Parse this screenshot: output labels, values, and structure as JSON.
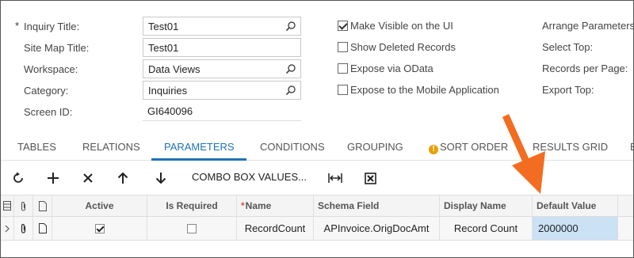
{
  "form": {
    "required_star": "*",
    "inquiry_title": {
      "label": "Inquiry Title:",
      "value": "Test01"
    },
    "site_map_title": {
      "label": "Site Map Title:",
      "value": "Test01"
    },
    "workspace": {
      "label": "Workspace:",
      "value": "Data Views"
    },
    "category": {
      "label": "Category:",
      "value": "Inquiries"
    },
    "screen_id": {
      "label": "Screen ID:",
      "value": "GI640096"
    }
  },
  "options": {
    "make_visible": {
      "label": "Make Visible on the UI",
      "checked": true
    },
    "show_deleted": {
      "label": "Show Deleted Records",
      "checked": false
    },
    "expose_odata": {
      "label": "Expose via OData",
      "checked": false
    },
    "expose_mobile": {
      "label": "Expose to the Mobile Application",
      "checked": false
    }
  },
  "right_labels": {
    "arrange": "Arrange Parameters",
    "select_top": "Select Top:",
    "records_per_page": "Records per Page:",
    "export_top": "Export Top:"
  },
  "tabs": {
    "tables": "TABLES",
    "relations": "RELATIONS",
    "parameters": "PARAMETERS",
    "conditions": "CONDITIONS",
    "grouping": "GROUPING",
    "sort_order": "SORT ORDER",
    "results_grid": "RESULTS GRID",
    "more": "E",
    "active": "PARAMETERS"
  },
  "toolbar": {
    "combo_box_values": "COMBO BOX VALUES..."
  },
  "grid": {
    "headers": {
      "active": "Active",
      "is_required": "Is Required",
      "name": "Name",
      "schema_field": "Schema Field",
      "display_name": "Display Name",
      "default_value": "Default Value"
    },
    "row": {
      "active": true,
      "is_required": false,
      "name": "RecordCount",
      "schema_field": "APInvoice.OrigDocAmt",
      "display_name": "Record Count",
      "default_value": "2000000"
    }
  },
  "colors": {
    "accent": "#1f73b7",
    "arrow": "#f26d21",
    "selected_cell": "#cbe1f4",
    "warning": "#e8a000"
  }
}
